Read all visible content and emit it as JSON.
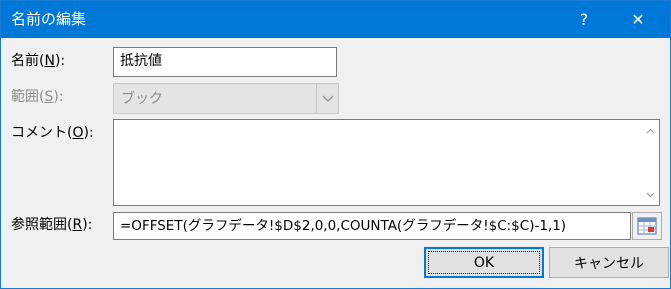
{
  "window": {
    "title": "名前の編集",
    "help_glyph": "?",
    "close_glyph": "✕"
  },
  "name_field": {
    "label_pre": "名前(",
    "label_key": "N",
    "label_post": "):",
    "value": "抵抗値"
  },
  "scope_field": {
    "label_pre": "範囲(",
    "label_key": "S",
    "label_post": "):",
    "value": "ブック",
    "disabled": true
  },
  "comment_field": {
    "label_pre": "コメント(",
    "label_key": "O",
    "label_post": "):",
    "value": ""
  },
  "refers_to_field": {
    "label_pre": "参照範囲(",
    "label_key": "R",
    "label_post": "):",
    "value": "=OFFSET(グラフデータ!$D$2,0,0,COUNTA(グラフデータ!$C:$C)-1,1)"
  },
  "buttons": {
    "ok_label": "OK",
    "cancel_label": "キャンセル"
  },
  "icons": {
    "help": "help-icon",
    "close": "close-icon",
    "combo_arrow": "chevron-down-icon",
    "scroll_up": "scroll-up-arrow-icon",
    "scroll_down": "scroll-down-arrow-icon",
    "range_picker": "range-selector-icon"
  },
  "colors": {
    "titlebar": "#0078d7",
    "dialog_bg": "#f0f0f0",
    "disabled_text": "#8d8d8d"
  }
}
